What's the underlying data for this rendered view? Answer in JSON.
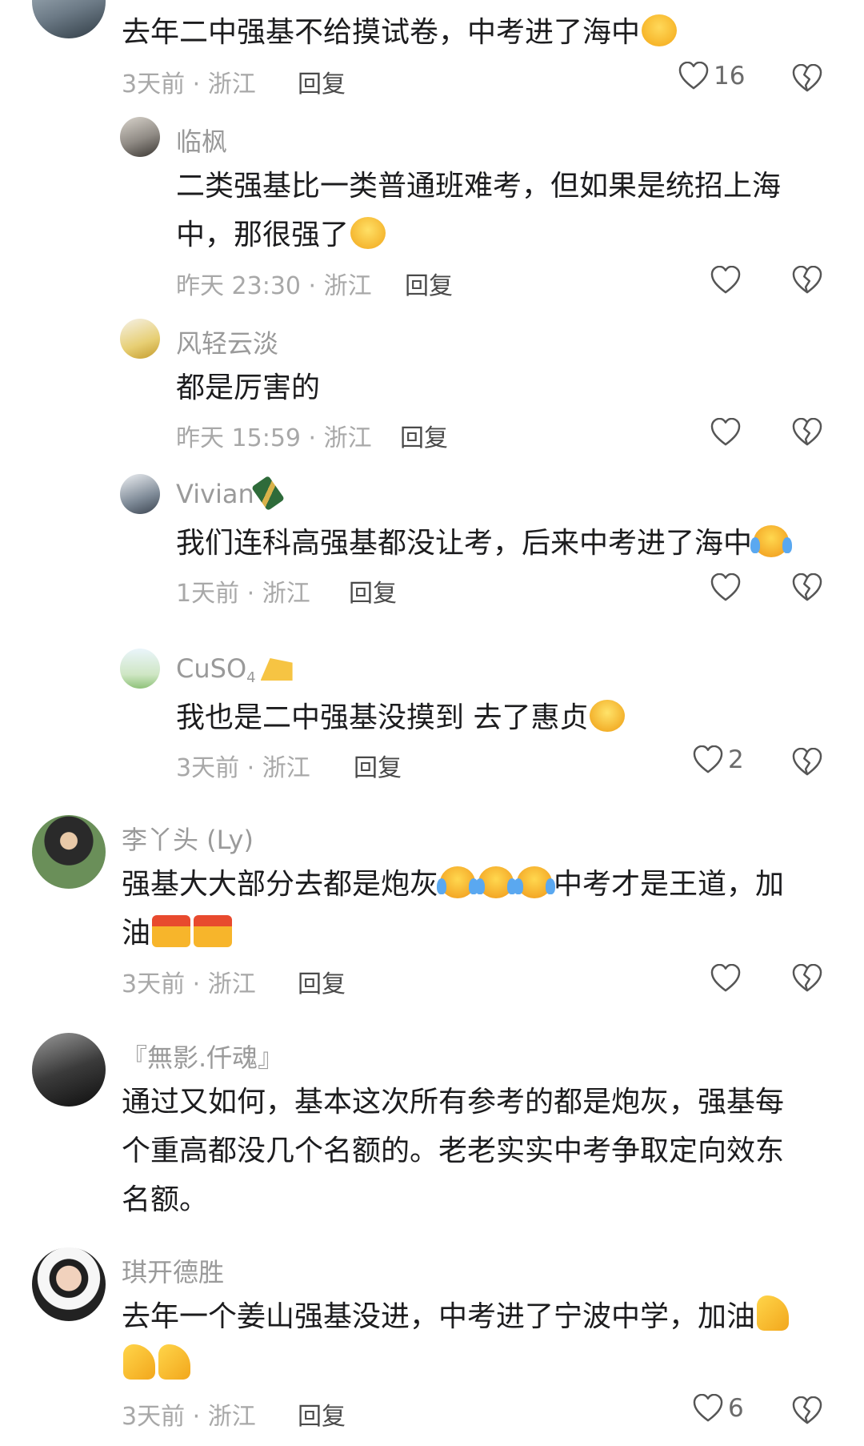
{
  "comments": [
    {
      "name": "",
      "text": "去年二中强基不给摸试卷，中考进了海中",
      "time": "3天前",
      "location": "浙江",
      "reply_label": "回复",
      "likes": "16"
    },
    {
      "name": "临枫",
      "text_line1": "二类强基比一类普通班难考，但如果是统招上海",
      "text_line2": "中，那很强了",
      "time": "昨天 23:30",
      "location": "浙江",
      "reply_label": "回复",
      "likes": ""
    },
    {
      "name": "风轻云淡",
      "text": "都是厉害的",
      "time": "昨天 15:59",
      "location": "浙江",
      "reply_label": "回复",
      "likes": ""
    },
    {
      "name": "Vivian",
      "text": "我们连科高强基都没让考，后来中考进了海中",
      "time": "1天前",
      "location": "浙江",
      "reply_label": "回复",
      "likes": ""
    },
    {
      "name": "CuSO",
      "name_sub": "4",
      "text": "我也是二中强基没摸到 去了惠贞",
      "time": "3天前",
      "location": "浙江",
      "reply_label": "回复",
      "likes": "2"
    },
    {
      "name": "李丫头 (Ly)",
      "text_line1": "强基大大部分去都是炮灰",
      "text_line1b": "中考才是王道，加",
      "text_line2": "油",
      "time": "3天前",
      "location": "浙江",
      "reply_label": "回复",
      "likes": ""
    },
    {
      "name": "『無影.仟魂』",
      "text_line1": "通过又如何，基本这次所有参考的都是炮灰，强基每",
      "text_line2": "个重高都没几个名额的。老老实实中考争取定向效东",
      "text_line3": "名额。"
    },
    {
      "name": "琪开德胜",
      "text_line1": "去年一个姜山强基没进，中考进了宁波中学，加油",
      "time": "3天前",
      "location": "浙江",
      "reply_label": "回复",
      "likes": "6"
    }
  ],
  "separator": "·",
  "icons": {
    "like": "heart-outline-icon",
    "dislike": "broken-heart-icon"
  },
  "colors": {
    "meta": "#a8a8a8",
    "name": "#9a9a9a",
    "text": "#1c1c1e"
  }
}
